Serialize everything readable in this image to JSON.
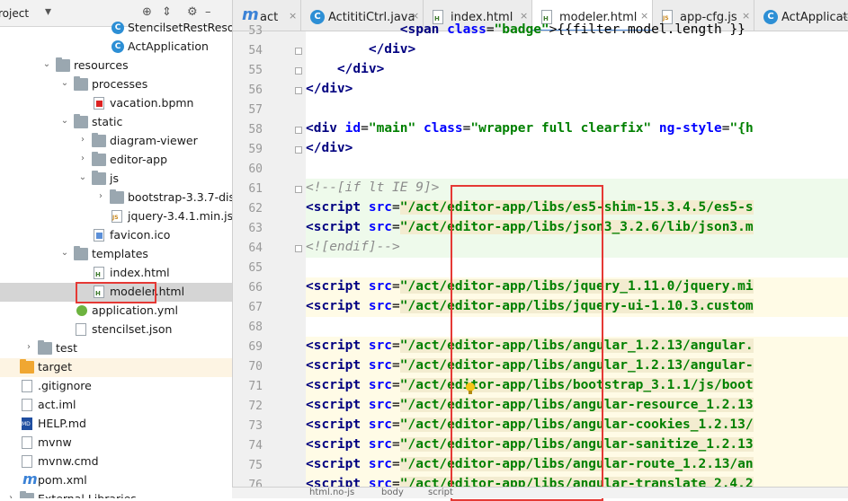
{
  "project": {
    "title": "roject",
    "tree": [
      {
        "label": "StencilsetRestResou...",
        "depth": 5,
        "icon": "java-class-icon",
        "arrow": ""
      },
      {
        "label": "ActApplication",
        "depth": 5,
        "icon": "spring-app-icon",
        "arrow": ""
      },
      {
        "label": "resources",
        "depth": 2,
        "icon": "resources-folder-icon",
        "arrow": "open"
      },
      {
        "label": "processes",
        "depth": 3,
        "icon": "folder-icon",
        "arrow": "open"
      },
      {
        "label": "vacation.bpmn",
        "depth": 4,
        "icon": "bpmn-file-icon",
        "arrow": ""
      },
      {
        "label": "static",
        "depth": 3,
        "icon": "folder-icon",
        "arrow": "open"
      },
      {
        "label": "diagram-viewer",
        "depth": 4,
        "icon": "folder-icon",
        "arrow": "closed"
      },
      {
        "label": "editor-app",
        "depth": 4,
        "icon": "folder-icon",
        "arrow": "closed"
      },
      {
        "label": "js",
        "depth": 4,
        "icon": "folder-icon",
        "arrow": "open"
      },
      {
        "label": "bootstrap-3.3.7-dist",
        "depth": 5,
        "icon": "folder-icon",
        "arrow": "closed"
      },
      {
        "label": "jquery-3.4.1.min.js",
        "depth": 5,
        "icon": "js-file-icon",
        "arrow": ""
      },
      {
        "label": "favicon.ico",
        "depth": 4,
        "icon": "ico-file-icon",
        "arrow": ""
      },
      {
        "label": "templates",
        "depth": 3,
        "icon": "folder-icon",
        "arrow": "open"
      },
      {
        "label": "index.html",
        "depth": 4,
        "icon": "html-file-icon",
        "arrow": ""
      },
      {
        "label": "modeler.html",
        "depth": 4,
        "icon": "html-file-icon",
        "arrow": "",
        "selected": true
      },
      {
        "label": "application.yml",
        "depth": 3,
        "icon": "yml-file-icon",
        "arrow": ""
      },
      {
        "label": "stencilset.json",
        "depth": 3,
        "icon": "json-file-icon",
        "arrow": ""
      },
      {
        "label": "test",
        "depth": 1,
        "icon": "folder-icon",
        "arrow": "closed"
      },
      {
        "label": "target",
        "depth": 0,
        "icon": "target-folder-icon",
        "arrow": "",
        "highlight": true
      },
      {
        "label": ".gitignore",
        "depth": 0,
        "icon": "text-file-icon",
        "arrow": ""
      },
      {
        "label": "act.iml",
        "depth": 0,
        "icon": "iml-file-icon",
        "arrow": ""
      },
      {
        "label": "HELP.md",
        "depth": 0,
        "icon": "md-file-icon",
        "arrow": ""
      },
      {
        "label": "mvnw",
        "depth": 0,
        "icon": "text-file-icon",
        "arrow": ""
      },
      {
        "label": "mvnw.cmd",
        "depth": 0,
        "icon": "text-file-icon",
        "arrow": ""
      },
      {
        "label": "pom.xml",
        "depth": 0,
        "icon": "maven-file-icon",
        "arrow": ""
      },
      {
        "label": "External Libraries",
        "depth": 0,
        "icon": "library-icon",
        "arrow": "closed"
      }
    ]
  },
  "tabs": [
    {
      "label": "act",
      "icon": "m"
    },
    {
      "label": "ActititiCtrl.java",
      "icon": "c"
    },
    {
      "label": "index.html",
      "icon": "h"
    },
    {
      "label": "modeler.html",
      "icon": "h",
      "active": true
    },
    {
      "label": "app-cfg.js",
      "icon": "j"
    },
    {
      "label": "ActApplicati",
      "icon": "c"
    }
  ],
  "close_glyph": "×",
  "editor": {
    "lines": [
      {
        "n": "53",
        "parts": [
          [
            "p",
            "            "
          ],
          [
            "t",
            "<span"
          ],
          [
            "p",
            " "
          ],
          [
            "a",
            "class"
          ],
          [
            "p",
            "="
          ],
          [
            "s",
            "\"badge\""
          ],
          [
            "p",
            ">{{filter.model.length }}"
          ]
        ]
      },
      {
        "n": "54",
        "parts": [
          [
            "p",
            "        "
          ],
          [
            "t",
            "</div>"
          ]
        ]
      },
      {
        "n": "55",
        "parts": [
          [
            "p",
            "    "
          ],
          [
            "t",
            "</div>"
          ]
        ]
      },
      {
        "n": "56",
        "parts": [
          [
            "t",
            "</div>"
          ]
        ]
      },
      {
        "n": "57",
        "parts": []
      },
      {
        "n": "58",
        "parts": [
          [
            "t",
            "<div"
          ],
          [
            "p",
            " "
          ],
          [
            "a",
            "id"
          ],
          [
            "p",
            "="
          ],
          [
            "s",
            "\"main\""
          ],
          [
            "p",
            " "
          ],
          [
            "a",
            "class"
          ],
          [
            "p",
            "="
          ],
          [
            "s",
            "\"wrapper full clearfix\""
          ],
          [
            "p",
            " "
          ],
          [
            "a",
            "ng-style"
          ],
          [
            "p",
            "="
          ],
          [
            "s",
            "\"{h"
          ]
        ]
      },
      {
        "n": "59",
        "parts": [
          [
            "t",
            "</div>"
          ]
        ]
      },
      {
        "n": "60",
        "parts": []
      },
      {
        "n": "61",
        "parts": [
          [
            "c",
            "<!--[if lt IE 9]>"
          ]
        ]
      },
      {
        "n": "62",
        "parts": [
          [
            "t",
            "<script"
          ],
          [
            "p",
            " "
          ],
          [
            "a",
            "src"
          ],
          [
            "p",
            "="
          ],
          [
            "s",
            "\"/act/editor-app/libs/es5-shim-15.3.4.5/es5-s"
          ]
        ]
      },
      {
        "n": "63",
        "parts": [
          [
            "t",
            "<script"
          ],
          [
            "p",
            " "
          ],
          [
            "a",
            "src"
          ],
          [
            "p",
            "="
          ],
          [
            "s",
            "\"/act/editor-app/libs/json3_3.2.6/lib/json3.m"
          ]
        ]
      },
      {
        "n": "64",
        "parts": [
          [
            "c",
            "<![endif]-->"
          ]
        ]
      },
      {
        "n": "65",
        "parts": []
      },
      {
        "n": "66",
        "parts": [
          [
            "t",
            "<script"
          ],
          [
            "p",
            " "
          ],
          [
            "a",
            "src"
          ],
          [
            "p",
            "="
          ],
          [
            "s",
            "\"/act/editor-app/libs/jquery_1.11.0/jquery.mi"
          ]
        ]
      },
      {
        "n": "67",
        "parts": [
          [
            "t",
            "<script"
          ],
          [
            "p",
            " "
          ],
          [
            "a",
            "src"
          ],
          [
            "p",
            "="
          ],
          [
            "s",
            "\"/act/editor-app/libs/jquery-ui-1.10.3.custom"
          ]
        ]
      },
      {
        "n": "68",
        "parts": []
      },
      {
        "n": "69",
        "parts": [
          [
            "t",
            "<script"
          ],
          [
            "p",
            " "
          ],
          [
            "a",
            "src"
          ],
          [
            "p",
            "="
          ],
          [
            "s",
            "\"/act/editor-app/libs/angular_1.2.13/angular."
          ]
        ]
      },
      {
        "n": "70",
        "parts": [
          [
            "t",
            "<script"
          ],
          [
            "p",
            " "
          ],
          [
            "a",
            "src"
          ],
          [
            "p",
            "="
          ],
          [
            "s",
            "\"/act/editor-app/libs/angular_1.2.13/angular-"
          ]
        ]
      },
      {
        "n": "71",
        "parts": [
          [
            "t",
            "<script"
          ],
          [
            "p",
            " "
          ],
          [
            "a",
            "src"
          ],
          [
            "p",
            "="
          ],
          [
            "s",
            "\"/act/editor-app/libs/bootstrap_3.1.1/js/boot"
          ]
        ]
      },
      {
        "n": "72",
        "parts": [
          [
            "t",
            "<script"
          ],
          [
            "p",
            " "
          ],
          [
            "a",
            "src"
          ],
          [
            "p",
            "="
          ],
          [
            "s",
            "\"/act/editor-app/libs/angular-resource_1.2.13"
          ]
        ]
      },
      {
        "n": "73",
        "parts": [
          [
            "t",
            "<script"
          ],
          [
            "p",
            " "
          ],
          [
            "a",
            "src"
          ],
          [
            "p",
            "="
          ],
          [
            "s",
            "\"/act/editor-app/libs/angular-cookies_1.2.13/"
          ]
        ]
      },
      {
        "n": "74",
        "parts": [
          [
            "t",
            "<script"
          ],
          [
            "p",
            " "
          ],
          [
            "a",
            "src"
          ],
          [
            "p",
            "="
          ],
          [
            "s",
            "\"/act/editor-app/libs/angular-sanitize_1.2.13"
          ]
        ]
      },
      {
        "n": "75",
        "parts": [
          [
            "t",
            "<script"
          ],
          [
            "p",
            " "
          ],
          [
            "a",
            "src"
          ],
          [
            "p",
            "="
          ],
          [
            "s",
            "\"/act/editor-app/libs/angular-route_1.2.13/an"
          ]
        ]
      },
      {
        "n": "76",
        "parts": [
          [
            "t",
            "<script"
          ],
          [
            "p",
            " "
          ],
          [
            "a",
            "src"
          ],
          [
            "p",
            "="
          ],
          [
            "s",
            "\"/act/editor-app/libs/angular-translate_2.4.2"
          ]
        ]
      }
    ]
  },
  "breadcrumb": [
    "html.no-js",
    "body",
    "script"
  ]
}
